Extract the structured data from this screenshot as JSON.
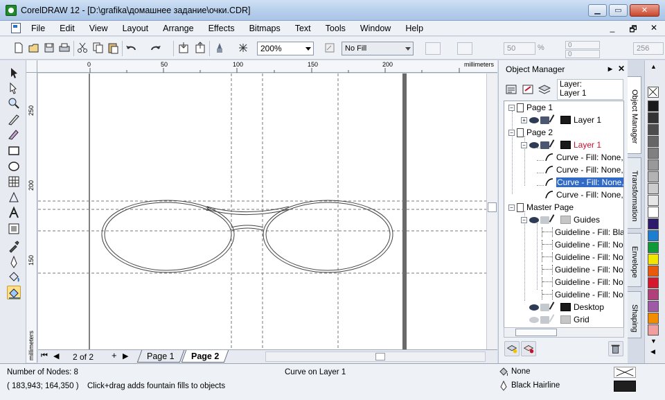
{
  "window": {
    "title": "CorelDRAW 12 - [D:\\grafika\\домашнее задание\\очки.CDR]",
    "minimize": "▁",
    "maximize": "▭",
    "close": "✕"
  },
  "menu": {
    "items": [
      "File",
      "Edit",
      "View",
      "Layout",
      "Arrange",
      "Effects",
      "Bitmaps",
      "Text",
      "Tools",
      "Window",
      "Help"
    ],
    "mdi_minimize": "_",
    "mdi_restore": "🗗",
    "mdi_close": "✕"
  },
  "toolbar": {
    "zoom": "200%",
    "fill": "No Fill",
    "field_50": "50",
    "field_0a": "0",
    "field_0b": "0",
    "field_256": "256",
    "percent": "%"
  },
  "ruler": {
    "unit": "millimeters",
    "top_labels": [
      "0",
      "50",
      "100",
      "150",
      "200"
    ],
    "left_labels": [
      "250",
      "200",
      "150"
    ],
    "left_unit": "millimeters"
  },
  "canvas": {
    "node_marker": "3"
  },
  "pagebar": {
    "first": "⏮",
    "prev": "◀",
    "count": "2 of 2",
    "add": "+",
    "next": "▶",
    "last": "⏭",
    "tabs": [
      "Page 1",
      "Page 2"
    ]
  },
  "docker": {
    "title": "Object Manager",
    "layer_label": "Layer:",
    "layer_name": "Layer 1",
    "tree": [
      {
        "label": "Page 1"
      },
      {
        "label": "Layer 1"
      },
      {
        "label": "Page 2"
      },
      {
        "label": "Layer 1"
      },
      {
        "label": "Curve - Fill: None,"
      },
      {
        "label": "Curve - Fill: None,"
      },
      {
        "label": "Curve - Fill: None,"
      },
      {
        "label": "Curve - Fill: None,"
      },
      {
        "label": "Master Page"
      },
      {
        "label": "Guides"
      },
      {
        "label": "Guideline - Fill: Bla"
      },
      {
        "label": "Guideline - Fill: No"
      },
      {
        "label": "Guideline - Fill: No"
      },
      {
        "label": "Guideline - Fill: No"
      },
      {
        "label": "Guideline - Fill: No"
      },
      {
        "label": "Guideline - Fill: No"
      },
      {
        "label": "Desktop"
      },
      {
        "label": "Grid"
      }
    ],
    "vertical_tabs": [
      "Object Manager",
      "Transformation",
      "Envelope",
      "Shaping"
    ]
  },
  "palette": {
    "colors": [
      "#1a1a1a",
      "#333333",
      "#4d4d4d",
      "#666666",
      "#808080",
      "#999999",
      "#b3b3b3",
      "#cccccc",
      "#e6e6e6",
      "#ffffff",
      "#2e1a6b",
      "#1a7fd1",
      "#0f9a3a",
      "#f2e500",
      "#e85a0c",
      "#d6182e",
      "#b13f7a",
      "#9e5aa8",
      "#f28c00",
      "#f29e9e"
    ]
  },
  "status": {
    "nodes": "Number of Nodes: 8",
    "coords": "( 183,943; 164,350 )",
    "hint": "Click+drag adds fountain fills to objects",
    "curve_info": "Curve on Layer 1",
    "fill": "None",
    "outline": "Black  Hairline"
  }
}
